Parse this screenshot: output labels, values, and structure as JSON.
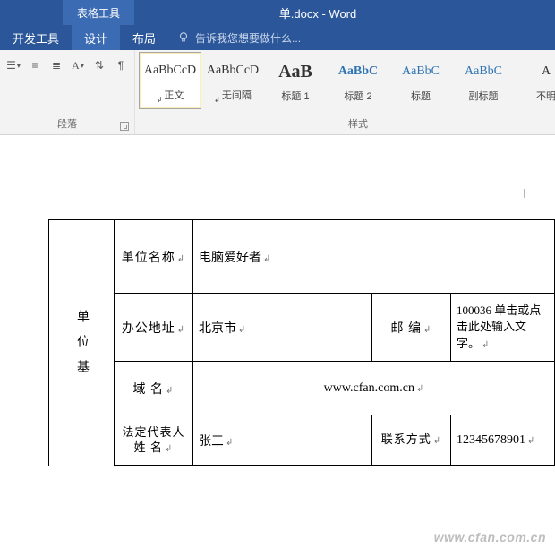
{
  "titlebar": {
    "table_tools": "表格工具",
    "doc_title": "单.docx - Word"
  },
  "tabs": {
    "dev": "开发工具",
    "design": "设计",
    "layout": "布局",
    "tellme_placeholder": "告诉我您想要做什么..."
  },
  "groups": {
    "paragraph": "段落",
    "styles": "样式"
  },
  "styles": [
    {
      "preview": "AaBbCcD",
      "name": "正文",
      "sel": true,
      "corner": true,
      "cls": ""
    },
    {
      "preview": "AaBbCcD",
      "name": "无间隔",
      "sel": false,
      "corner": true,
      "cls": ""
    },
    {
      "preview": "AaB",
      "name": "标题 1",
      "sel": false,
      "corner": false,
      "cls": "big"
    },
    {
      "preview": "AaBbC",
      "name": "标题 2",
      "sel": false,
      "corner": false,
      "cls": "semi"
    },
    {
      "preview": "AaBbC",
      "name": "标题",
      "sel": false,
      "corner": false,
      "cls": "blue"
    },
    {
      "preview": "AaBbC",
      "name": "副标题",
      "sel": false,
      "corner": false,
      "cls": "blue"
    },
    {
      "preview": "A",
      "name": "不明",
      "sel": false,
      "corner": false,
      "cls": ""
    }
  ],
  "table": {
    "side": "单位基",
    "r1": {
      "label": "单位名称",
      "value": "电脑爱好者"
    },
    "r2": {
      "label": "办公地址",
      "value": "北京市",
      "label2": "邮 编",
      "value2": "100036 单击或点击此处输入文字。"
    },
    "r3": {
      "label": "域 名",
      "value": "www.cfan.com.cn"
    },
    "r4": {
      "label": "法定代表人姓    名",
      "value": "张三",
      "label2": "联系方式",
      "value2": "12345678901"
    }
  },
  "watermark": "www.cfan.com.cn",
  "para_mark": "↲"
}
